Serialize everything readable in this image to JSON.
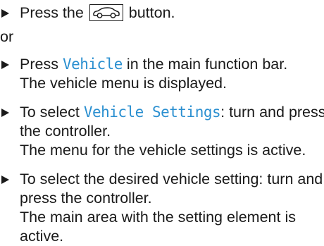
{
  "steps": [
    {
      "before": "Press the ",
      "icon": "car-button-icon",
      "after": " button."
    },
    {
      "before": "Press ",
      "highlight": "Vehicle",
      "after": " in the main function bar.",
      "result": "The vehicle menu is displayed."
    },
    {
      "before": "To select ",
      "highlight": "Vehicle Settings",
      "after": ": turn and press the controller.",
      "result": "The menu for the vehicle settings is active."
    },
    {
      "text": "To select the desired vehicle setting: turn and press the controller.",
      "result": "The main area with the setting element is active."
    }
  ],
  "or_text": "or",
  "colors": {
    "highlight": "#2a8fd0",
    "text": "#1a1a1a"
  }
}
